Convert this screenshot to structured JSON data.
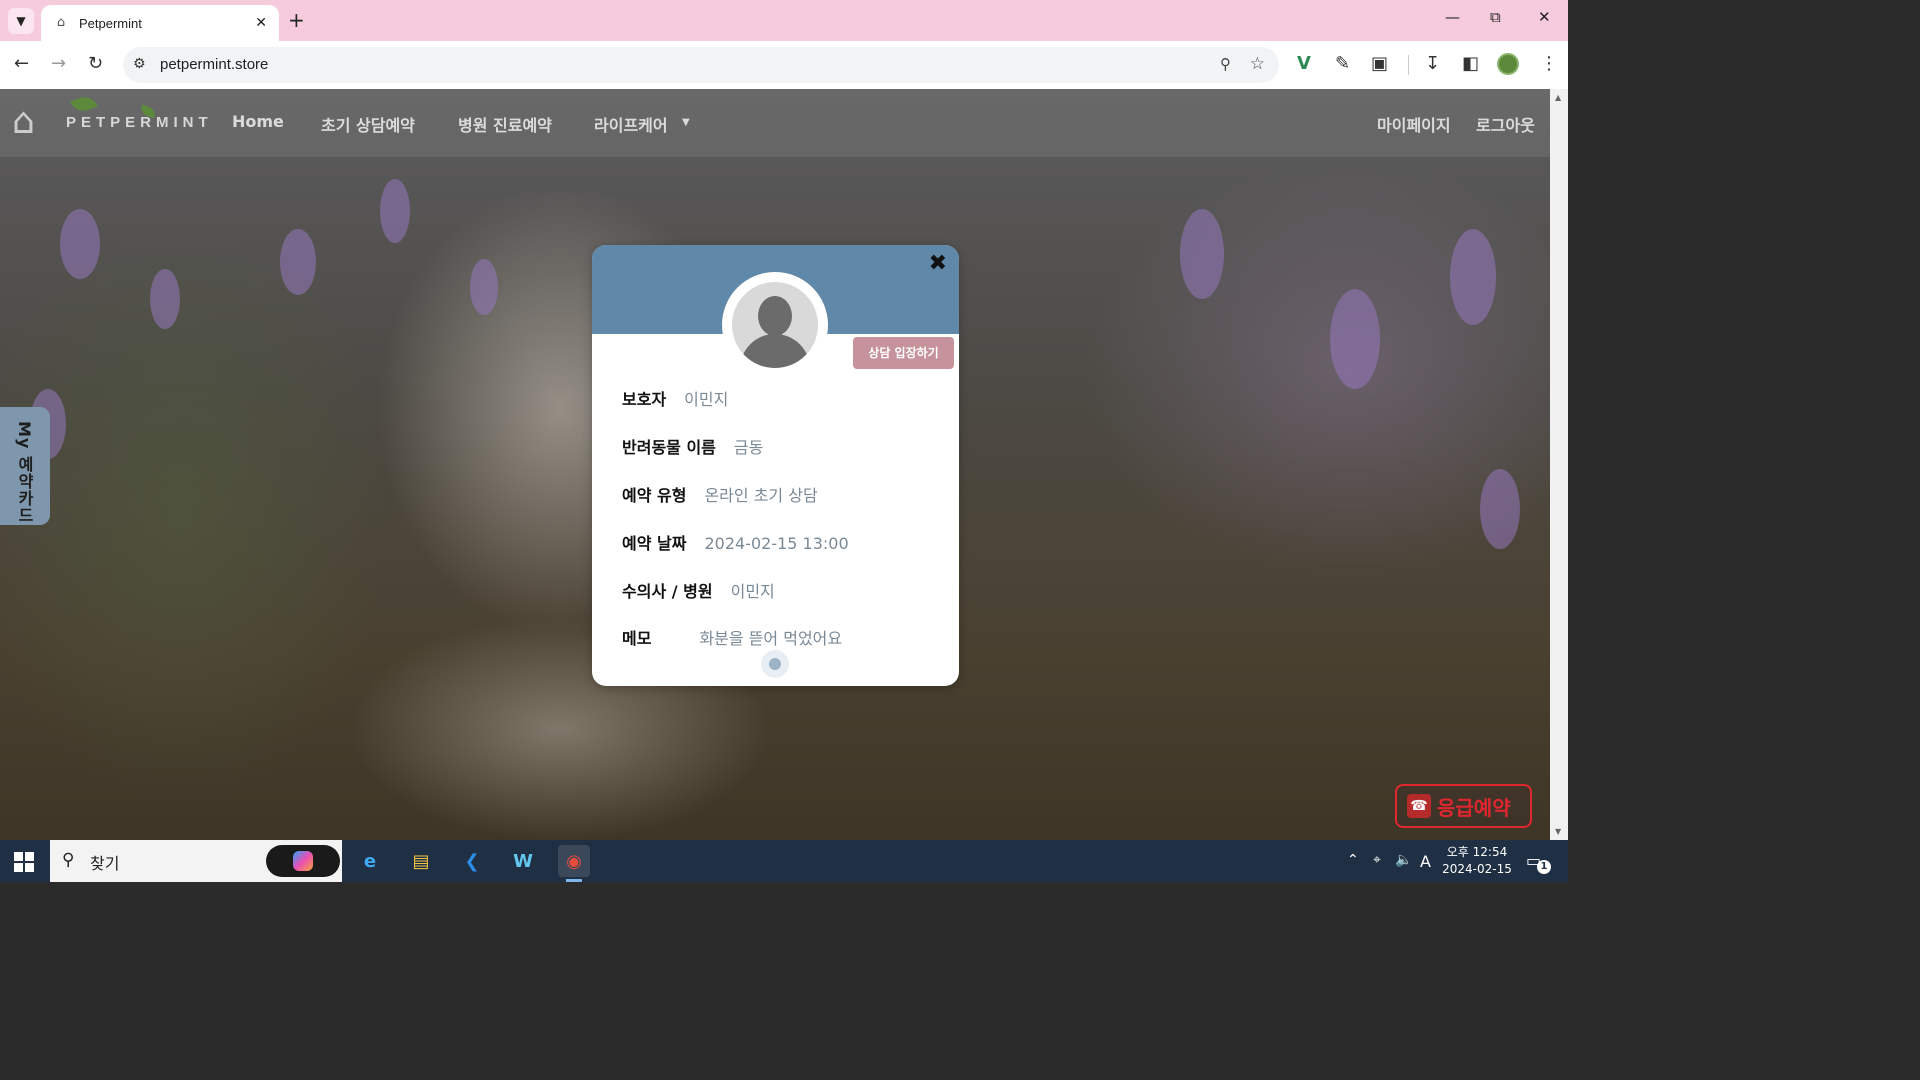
{
  "browser": {
    "tab_title": "Petpermint",
    "url": "petpermint.store",
    "colors": {
      "tabstrip": "#f6cbdb",
      "toolbar": "#ffffff"
    }
  },
  "site": {
    "logo_text": "PETPERMINT",
    "nav": {
      "home": "Home",
      "initial_consult": "초기 상담예약",
      "hospital": "병원 진료예약",
      "lifecare": "라이프케어",
      "mypage": "마이페이지",
      "logout": "로그아웃"
    },
    "side_tab": "My 예약카드",
    "emergency": "응급예약",
    "colors": {
      "modal_header": "#6088a8",
      "enter_button": "#c6929c",
      "side_tab": "#7f97ad",
      "emergency": "#e0262f"
    }
  },
  "modal": {
    "enter_button": "상담 입장하기",
    "fields": [
      {
        "label": "보호자",
        "value": "이민지"
      },
      {
        "label": "반려동물 이름",
        "value": "금동"
      },
      {
        "label": "예약 유형",
        "value": "온라인 초기 상담"
      },
      {
        "label": "예약 날짜",
        "value": "2024-02-15 13:00"
      },
      {
        "label": "수의사 / 병원",
        "value": "이민지"
      },
      {
        "label": "메모",
        "value": "화분을 뜯어 먹었어요"
      }
    ]
  },
  "taskbar": {
    "search_text": "찾기",
    "ime": "A",
    "time": "오후 12:54",
    "date": "2024-02-15",
    "notification_count": "1"
  }
}
